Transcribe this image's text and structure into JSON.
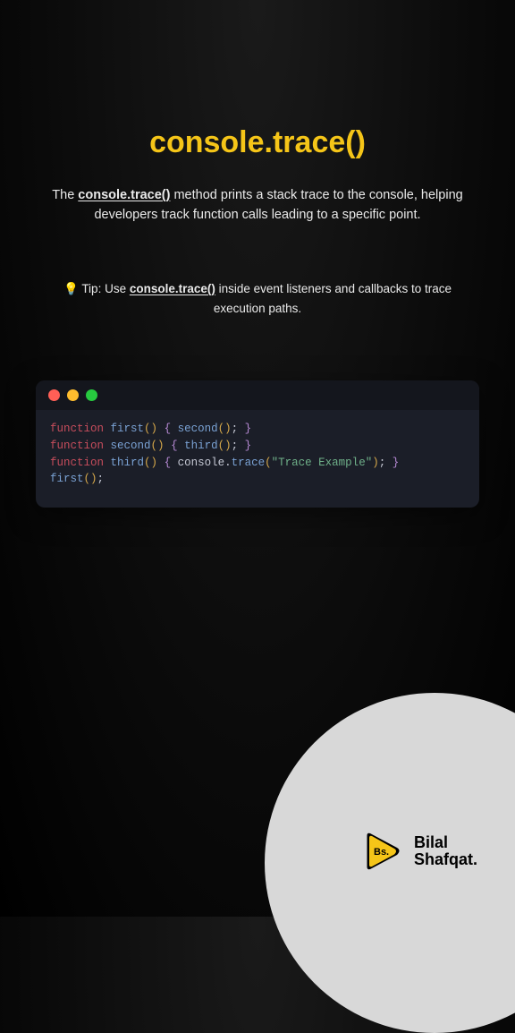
{
  "title": "console.trace()",
  "description": {
    "prefix": "The ",
    "bold": "console.trace()",
    "suffix": " method prints a stack trace to the console, helping developers track function calls leading to a specific point."
  },
  "tip": {
    "prefix": "💡 Tip: Use ",
    "bold": "console.trace()",
    "suffix": " inside event listeners and callbacks to trace execution paths."
  },
  "code": {
    "line1_kw": "function",
    "line1_fn": "first",
    "line1_call": "second",
    "line2_kw": "function",
    "line2_fn": "second",
    "line2_call": "third",
    "line3_kw": "function",
    "line3_fn": "third",
    "line3_obj": "console",
    "line3_method": "trace",
    "line3_str": "\"Trace Example\"",
    "line4_call": "first"
  },
  "brand": {
    "line1": "Bilal",
    "line2": "Shafqat.",
    "logo_text": "Bs."
  }
}
